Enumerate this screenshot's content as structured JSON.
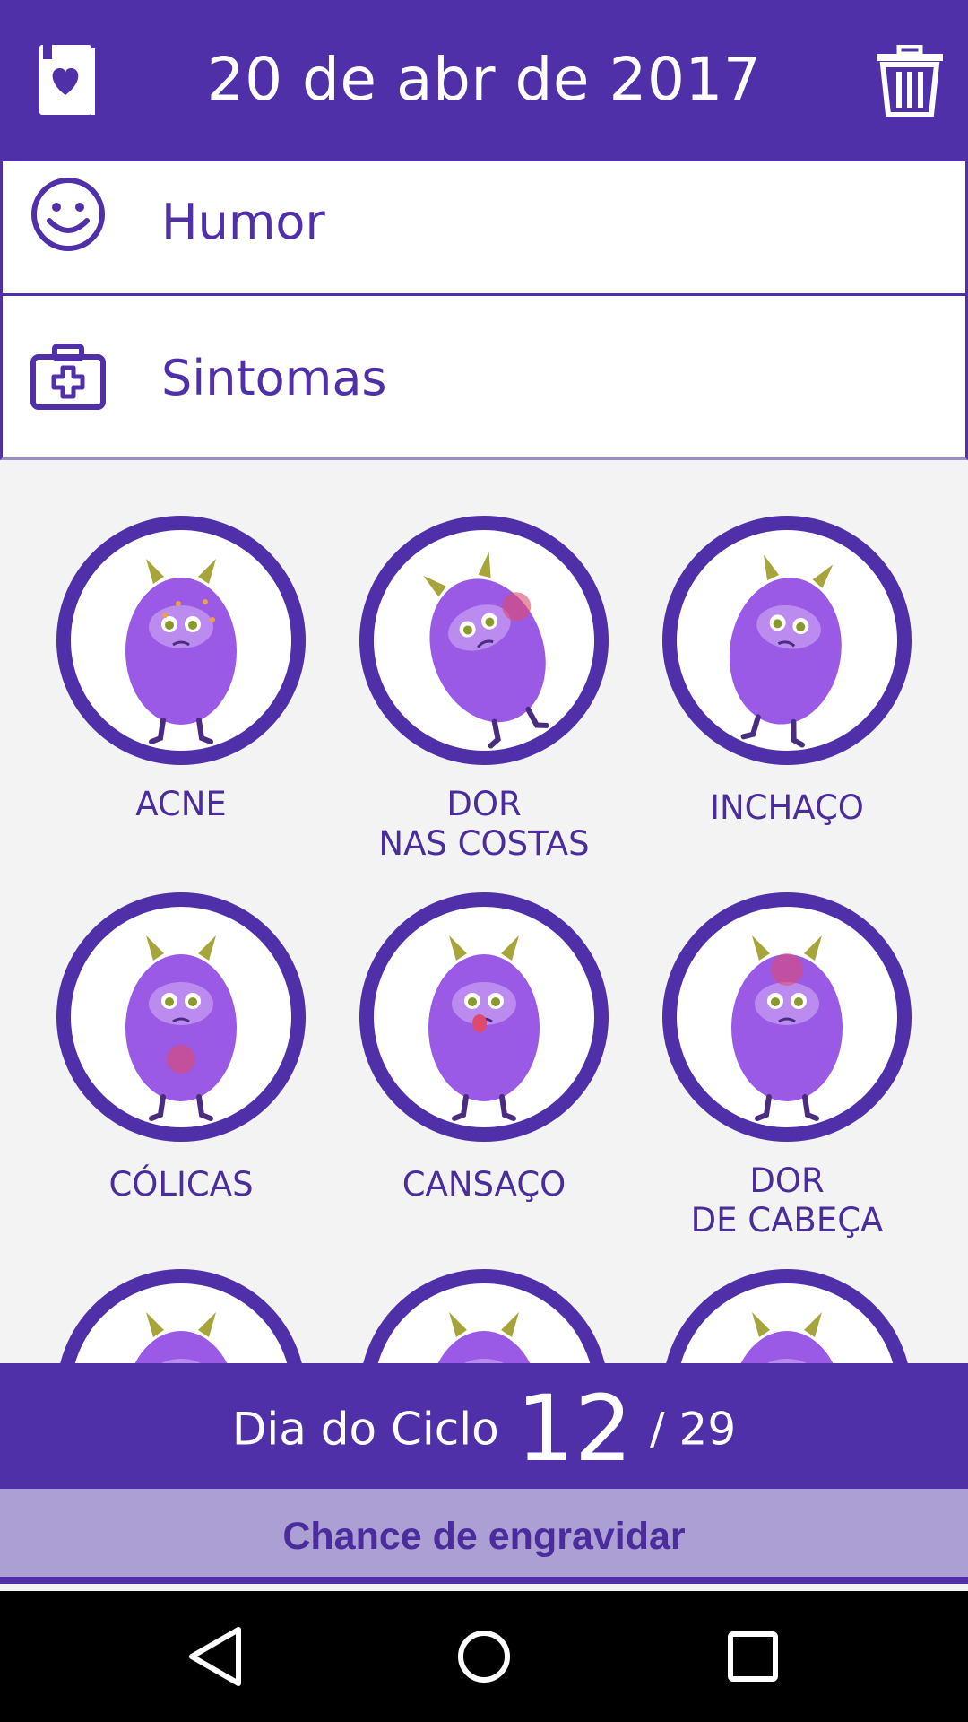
{
  "header": {
    "title": "20 de abr de 2017",
    "left_icon": "heart-card-icon",
    "right_icon": "trash-icon"
  },
  "rows": {
    "humor": {
      "label": "Humor",
      "icon": "smiley-icon"
    },
    "sintomas": {
      "label": "Sintomas",
      "icon": "first-aid-kit-icon"
    }
  },
  "symptoms": [
    {
      "label": "ACNE"
    },
    {
      "label": "DOR\nNAS COSTAS"
    },
    {
      "label": "INCHAÇO"
    },
    {
      "label": "CÓLICAS"
    },
    {
      "label": "CANSAÇO"
    },
    {
      "label": "DOR\nDE CABEÇA"
    },
    {
      "label": ""
    },
    {
      "label": ""
    },
    {
      "label": ""
    }
  ],
  "cycle": {
    "prefix": "Dia do Ciclo",
    "day": "12",
    "total": "/ 29"
  },
  "chance": {
    "label": "Chance de engravidar"
  },
  "colors": {
    "primary": "#5030a8",
    "light": "#ac9fd4",
    "monster": "#9a5ae6"
  },
  "navbar": {
    "back_icon": "back-triangle-icon",
    "home_icon": "home-circle-icon",
    "recents_icon": "recents-square-icon"
  }
}
